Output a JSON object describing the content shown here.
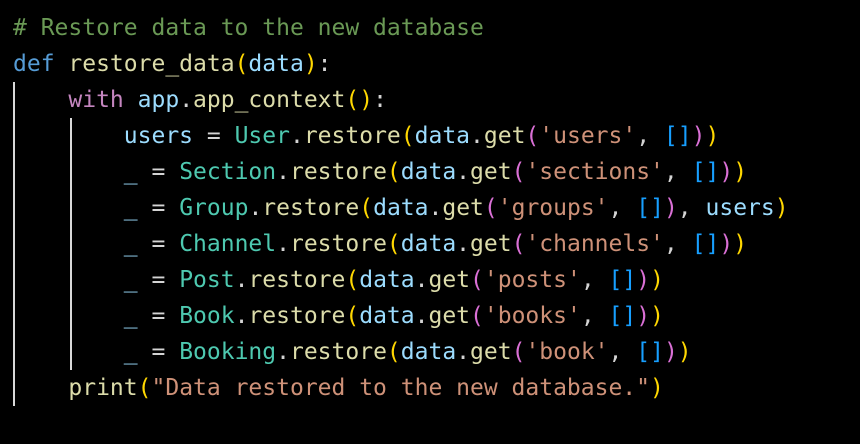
{
  "colors": {
    "background": "#000000",
    "comment": "#6a9955",
    "keyword": "#569cd6",
    "control": "#c586c0",
    "function": "#dcdcaa",
    "variable": "#9cdcfe",
    "class": "#4ec9b0",
    "string": "#ce9178",
    "bracket_gold": "#ffd700",
    "bracket_pink": "#da70d6",
    "bracket_blue": "#179fff",
    "operator": "#d4d4d4",
    "indent_guide": "#d9d9d9"
  },
  "code_lines": [
    [
      {
        "text": "# Restore data to the new database",
        "color": "#6a9955"
      }
    ],
    [
      {
        "text": "def ",
        "color": "#569cd6"
      },
      {
        "text": "restore_data",
        "color": "#dcdcaa"
      },
      {
        "text": "(",
        "color": "#ffd700"
      },
      {
        "text": "data",
        "color": "#9cdcfe"
      },
      {
        "text": ")",
        "color": "#ffd700"
      },
      {
        "text": ":",
        "color": "#d4d4d4"
      }
    ],
    [
      {
        "text": "    ",
        "color": "#d4d4d4"
      },
      {
        "text": "with ",
        "color": "#c586c0"
      },
      {
        "text": "app",
        "color": "#9cdcfe"
      },
      {
        "text": ".",
        "color": "#d4d4d4"
      },
      {
        "text": "app_context",
        "color": "#dcdcaa"
      },
      {
        "text": "()",
        "color": "#ffd700"
      },
      {
        "text": ":",
        "color": "#d4d4d4"
      }
    ],
    [
      {
        "text": "        ",
        "color": "#d4d4d4"
      },
      {
        "text": "users",
        "color": "#9cdcfe"
      },
      {
        "text": " = ",
        "color": "#d4d4d4"
      },
      {
        "text": "User",
        "color": "#4ec9b0"
      },
      {
        "text": ".",
        "color": "#d4d4d4"
      },
      {
        "text": "restore",
        "color": "#dcdcaa"
      },
      {
        "text": "(",
        "color": "#ffd700"
      },
      {
        "text": "data",
        "color": "#9cdcfe"
      },
      {
        "text": ".",
        "color": "#d4d4d4"
      },
      {
        "text": "get",
        "color": "#dcdcaa"
      },
      {
        "text": "(",
        "color": "#da70d6"
      },
      {
        "text": "'users'",
        "color": "#ce9178"
      },
      {
        "text": ", ",
        "color": "#d4d4d4"
      },
      {
        "text": "[]",
        "color": "#179fff"
      },
      {
        "text": ")",
        "color": "#da70d6"
      },
      {
        "text": ")",
        "color": "#ffd700"
      }
    ],
    [
      {
        "text": "        ",
        "color": "#d4d4d4"
      },
      {
        "text": "_",
        "color": "#9cdcfe"
      },
      {
        "text": " = ",
        "color": "#d4d4d4"
      },
      {
        "text": "Section",
        "color": "#4ec9b0"
      },
      {
        "text": ".",
        "color": "#d4d4d4"
      },
      {
        "text": "restore",
        "color": "#dcdcaa"
      },
      {
        "text": "(",
        "color": "#ffd700"
      },
      {
        "text": "data",
        "color": "#9cdcfe"
      },
      {
        "text": ".",
        "color": "#d4d4d4"
      },
      {
        "text": "get",
        "color": "#dcdcaa"
      },
      {
        "text": "(",
        "color": "#da70d6"
      },
      {
        "text": "'sections'",
        "color": "#ce9178"
      },
      {
        "text": ", ",
        "color": "#d4d4d4"
      },
      {
        "text": "[]",
        "color": "#179fff"
      },
      {
        "text": ")",
        "color": "#da70d6"
      },
      {
        "text": ")",
        "color": "#ffd700"
      }
    ],
    [
      {
        "text": "        ",
        "color": "#d4d4d4"
      },
      {
        "text": "_",
        "color": "#9cdcfe"
      },
      {
        "text": " = ",
        "color": "#d4d4d4"
      },
      {
        "text": "Group",
        "color": "#4ec9b0"
      },
      {
        "text": ".",
        "color": "#d4d4d4"
      },
      {
        "text": "restore",
        "color": "#dcdcaa"
      },
      {
        "text": "(",
        "color": "#ffd700"
      },
      {
        "text": "data",
        "color": "#9cdcfe"
      },
      {
        "text": ".",
        "color": "#d4d4d4"
      },
      {
        "text": "get",
        "color": "#dcdcaa"
      },
      {
        "text": "(",
        "color": "#da70d6"
      },
      {
        "text": "'groups'",
        "color": "#ce9178"
      },
      {
        "text": ", ",
        "color": "#d4d4d4"
      },
      {
        "text": "[]",
        "color": "#179fff"
      },
      {
        "text": ")",
        "color": "#da70d6"
      },
      {
        "text": ", ",
        "color": "#d4d4d4"
      },
      {
        "text": "users",
        "color": "#9cdcfe"
      },
      {
        "text": ")",
        "color": "#ffd700"
      }
    ],
    [
      {
        "text": "        ",
        "color": "#d4d4d4"
      },
      {
        "text": "_",
        "color": "#9cdcfe"
      },
      {
        "text": " = ",
        "color": "#d4d4d4"
      },
      {
        "text": "Channel",
        "color": "#4ec9b0"
      },
      {
        "text": ".",
        "color": "#d4d4d4"
      },
      {
        "text": "restore",
        "color": "#dcdcaa"
      },
      {
        "text": "(",
        "color": "#ffd700"
      },
      {
        "text": "data",
        "color": "#9cdcfe"
      },
      {
        "text": ".",
        "color": "#d4d4d4"
      },
      {
        "text": "get",
        "color": "#dcdcaa"
      },
      {
        "text": "(",
        "color": "#da70d6"
      },
      {
        "text": "'channels'",
        "color": "#ce9178"
      },
      {
        "text": ", ",
        "color": "#d4d4d4"
      },
      {
        "text": "[]",
        "color": "#179fff"
      },
      {
        "text": ")",
        "color": "#da70d6"
      },
      {
        "text": ")",
        "color": "#ffd700"
      }
    ],
    [
      {
        "text": "        ",
        "color": "#d4d4d4"
      },
      {
        "text": "_",
        "color": "#9cdcfe"
      },
      {
        "text": " = ",
        "color": "#d4d4d4"
      },
      {
        "text": "Post",
        "color": "#4ec9b0"
      },
      {
        "text": ".",
        "color": "#d4d4d4"
      },
      {
        "text": "restore",
        "color": "#dcdcaa"
      },
      {
        "text": "(",
        "color": "#ffd700"
      },
      {
        "text": "data",
        "color": "#9cdcfe"
      },
      {
        "text": ".",
        "color": "#d4d4d4"
      },
      {
        "text": "get",
        "color": "#dcdcaa"
      },
      {
        "text": "(",
        "color": "#da70d6"
      },
      {
        "text": "'posts'",
        "color": "#ce9178"
      },
      {
        "text": ", ",
        "color": "#d4d4d4"
      },
      {
        "text": "[]",
        "color": "#179fff"
      },
      {
        "text": ")",
        "color": "#da70d6"
      },
      {
        "text": ")",
        "color": "#ffd700"
      }
    ],
    [
      {
        "text": "        ",
        "color": "#d4d4d4"
      },
      {
        "text": "_",
        "color": "#9cdcfe"
      },
      {
        "text": " = ",
        "color": "#d4d4d4"
      },
      {
        "text": "Book",
        "color": "#4ec9b0"
      },
      {
        "text": ".",
        "color": "#d4d4d4"
      },
      {
        "text": "restore",
        "color": "#dcdcaa"
      },
      {
        "text": "(",
        "color": "#ffd700"
      },
      {
        "text": "data",
        "color": "#9cdcfe"
      },
      {
        "text": ".",
        "color": "#d4d4d4"
      },
      {
        "text": "get",
        "color": "#dcdcaa"
      },
      {
        "text": "(",
        "color": "#da70d6"
      },
      {
        "text": "'books'",
        "color": "#ce9178"
      },
      {
        "text": ", ",
        "color": "#d4d4d4"
      },
      {
        "text": "[]",
        "color": "#179fff"
      },
      {
        "text": ")",
        "color": "#da70d6"
      },
      {
        "text": ")",
        "color": "#ffd700"
      }
    ],
    [
      {
        "text": "        ",
        "color": "#d4d4d4"
      },
      {
        "text": "_",
        "color": "#9cdcfe"
      },
      {
        "text": " = ",
        "color": "#d4d4d4"
      },
      {
        "text": "Booking",
        "color": "#4ec9b0"
      },
      {
        "text": ".",
        "color": "#d4d4d4"
      },
      {
        "text": "restore",
        "color": "#dcdcaa"
      },
      {
        "text": "(",
        "color": "#ffd700"
      },
      {
        "text": "data",
        "color": "#9cdcfe"
      },
      {
        "text": ".",
        "color": "#d4d4d4"
      },
      {
        "text": "get",
        "color": "#dcdcaa"
      },
      {
        "text": "(",
        "color": "#da70d6"
      },
      {
        "text": "'book'",
        "color": "#ce9178"
      },
      {
        "text": ", ",
        "color": "#d4d4d4"
      },
      {
        "text": "[]",
        "color": "#179fff"
      },
      {
        "text": ")",
        "color": "#da70d6"
      },
      {
        "text": ")",
        "color": "#ffd700"
      }
    ],
    [
      {
        "text": "    ",
        "color": "#d4d4d4"
      },
      {
        "text": "print",
        "color": "#dcdcaa"
      },
      {
        "text": "(",
        "color": "#ffd700"
      },
      {
        "text": "\"Data restored to the new database.\"",
        "color": "#ce9178"
      },
      {
        "text": ")",
        "color": "#ffd700"
      }
    ]
  ]
}
